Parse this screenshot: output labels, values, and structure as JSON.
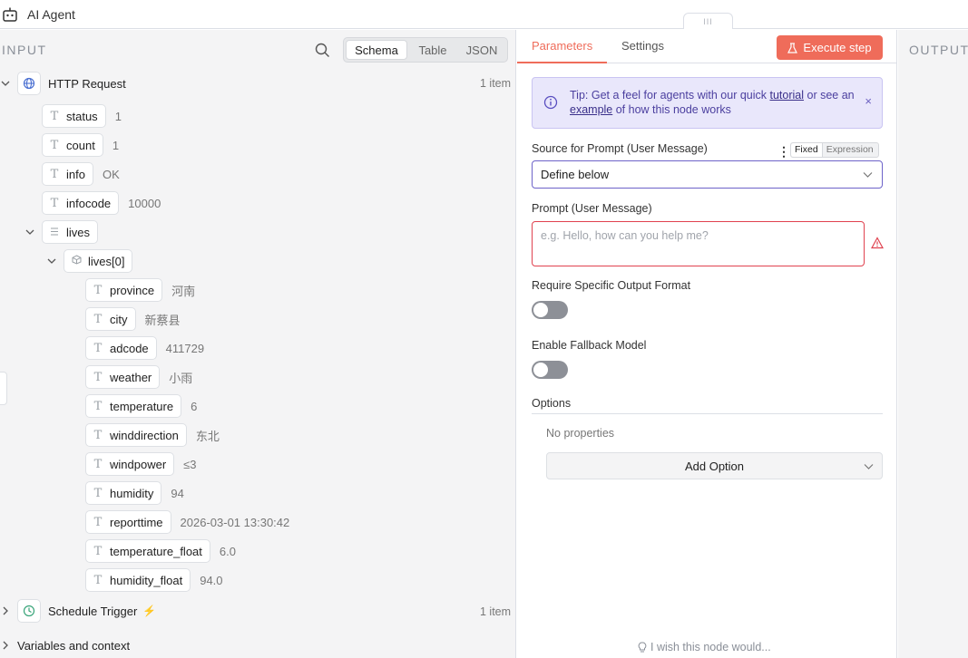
{
  "header": {
    "title": "AI Agent",
    "drag_handle": "III"
  },
  "input_panel": {
    "label": "INPUT",
    "views": [
      "Schema",
      "Table",
      "JSON"
    ],
    "active_view": "Schema",
    "http_node": {
      "name": "HTTP Request",
      "count": "1 item"
    },
    "fields": [
      {
        "key": "status",
        "value": "1"
      },
      {
        "key": "count",
        "value": "1"
      },
      {
        "key": "info",
        "value": "OK"
      },
      {
        "key": "infocode",
        "value": "10000"
      }
    ],
    "lives": {
      "key": "lives",
      "item_key": "lives[0]"
    },
    "live_fields": [
      {
        "key": "province",
        "value": "河南"
      },
      {
        "key": "city",
        "value": "新蔡县"
      },
      {
        "key": "adcode",
        "value": "411729"
      },
      {
        "key": "weather",
        "value": "小雨"
      },
      {
        "key": "temperature",
        "value": "6"
      },
      {
        "key": "winddirection",
        "value": "东北"
      },
      {
        "key": "windpower",
        "value": "≤3"
      },
      {
        "key": "humidity",
        "value": "94"
      },
      {
        "key": "reporttime",
        "value": "2026-03-01 13:30:42"
      },
      {
        "key": "temperature_float",
        "value": "6.0"
      },
      {
        "key": "humidity_float",
        "value": "94.0"
      }
    ],
    "schedule_node": {
      "name": "Schedule Trigger",
      "count": "1 item"
    },
    "variables": "Variables and context"
  },
  "params_panel": {
    "tabs": {
      "parameters": "Parameters",
      "settings": "Settings"
    },
    "execute_label": "Execute step",
    "tip": {
      "prefix": "Tip: Get a feel for agents with our quick ",
      "link1": "tutorial",
      "middle": " or see an ",
      "link2": "example",
      "suffix": " of how this node works",
      "close": "×"
    },
    "source_label": "Source for Prompt (User Message)",
    "fixed_label": "Fixed",
    "expression_label": "Expression",
    "source_value": "Define below",
    "prompt_label": "Prompt (User Message)",
    "prompt_placeholder": "e.g. Hello, how can you help me?",
    "require_format_label": "Require Specific Output Format",
    "fallback_label": "Enable Fallback Model",
    "options_label": "Options",
    "no_properties": "No properties",
    "add_option": "Add Option",
    "wish": "I wish this node would..."
  },
  "output_panel": {
    "label": "OUTPUT"
  },
  "colors": {
    "accent": "#ef6c5a",
    "tip_bg": "#e9e7fb",
    "error": "#e0424f"
  }
}
